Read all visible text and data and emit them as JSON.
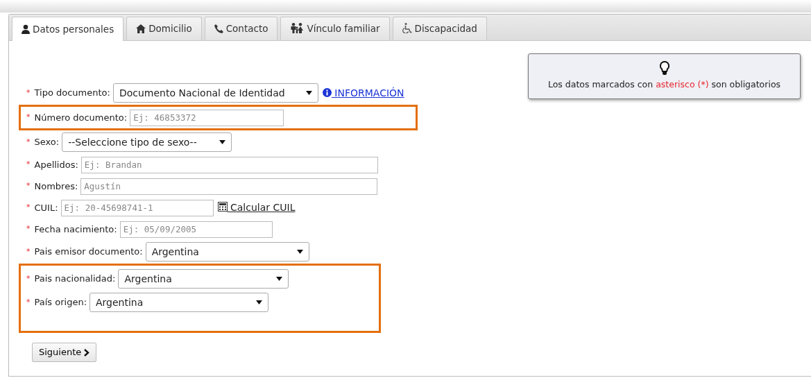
{
  "tabs": [
    {
      "label": "Datos personales",
      "selected": true
    },
    {
      "label": "Domicilio",
      "selected": false
    },
    {
      "label": "Contacto",
      "selected": false
    },
    {
      "label": "Vínculo familiar",
      "selected": false
    },
    {
      "label": "Discapacidad",
      "selected": false
    }
  ],
  "note": {
    "text_before": "Los datos marcados con",
    "highlight": "asterisco (*)",
    "text_after": "son obligatorios"
  },
  "field_groups": [
    {
      "highlighted": false,
      "fields": [
        {
          "kind": "select",
          "required_mark": "*",
          "label": "Tipo documento:",
          "value": "Documento Nacional de Identidad",
          "link": "INFORMACIÓN"
        }
      ]
    },
    {
      "highlighted": true,
      "fields": [
        {
          "kind": "text",
          "required_mark": "*",
          "label": "Número documento:",
          "placeholder": "Ej: 46853372"
        }
      ]
    },
    {
      "highlighted": false,
      "fields": [
        {
          "kind": "select",
          "required_mark": "*",
          "label": "Sexo:",
          "value": "--Seleccione tipo de sexo--"
        },
        {
          "kind": "text",
          "required_mark": "*",
          "label": "Apellidos:",
          "placeholder": "Ej: Brandan"
        },
        {
          "kind": "text",
          "required_mark": "*",
          "label": "Nombres:",
          "placeholder": "Agustín"
        },
        {
          "kind": "text",
          "required_mark": "*",
          "label": "CUIL:",
          "placeholder": "Ej: 20-45698741-1",
          "link": "Calcular CUIL"
        },
        {
          "kind": "text",
          "required_mark": "*",
          "label": "Fecha nacimiento:",
          "placeholder": "Ej: 05/09/2005"
        },
        {
          "kind": "select",
          "required_mark": "*",
          "label": "Pais emisor documento:",
          "value": "Argentina"
        }
      ]
    },
    {
      "highlighted": true,
      "fields": [
        {
          "kind": "select",
          "required_mark": "*",
          "label": "Pais nacionalidad:",
          "value": "Argentina"
        },
        {
          "kind": "select",
          "required_mark": "*",
          "label": "País origen:",
          "value": "Argentina"
        }
      ]
    }
  ],
  "next_button": "Siguiente"
}
